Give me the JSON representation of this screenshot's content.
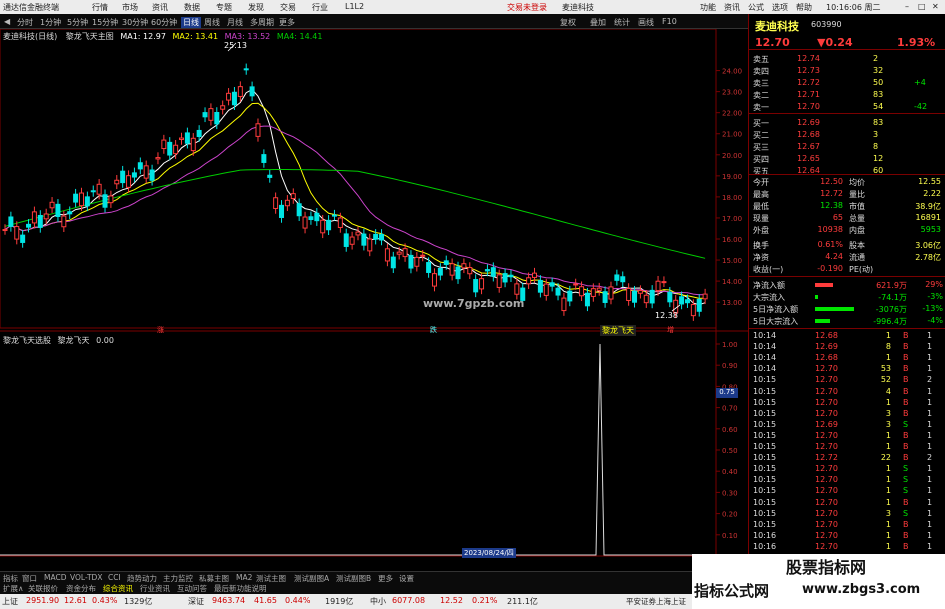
{
  "window": {
    "title": "通达信金融终端",
    "menu": [
      "行情",
      "市场",
      "资讯",
      "数据",
      "专题",
      "发现",
      "交易",
      "行业",
      "L1L2"
    ],
    "account": "交易未登录",
    "stock_tag": "麦迪科技",
    "right_menu": [
      "功能",
      "资讯",
      "公式",
      "选项",
      "帮助"
    ],
    "time": "10:16:06 周二"
  },
  "period_bar": {
    "items": [
      "分时",
      "1分钟",
      "5分钟",
      "15分钟",
      "30分钟",
      "60分钟",
      "日线",
      "周线",
      "月线",
      "多周期",
      "更多"
    ],
    "active": "日线"
  },
  "upper_chart": {
    "header_name": "麦迪科技(日线)",
    "header_formula": "黎龙飞天主图",
    "ma": [
      {
        "label": "MA1: 12.97",
        "color": "#ffffff"
      },
      {
        "label": "MA2: 13.41",
        "color": "#ffff00"
      },
      {
        "label": "MA3: 13.52",
        "color": "#cc44cc"
      },
      {
        "label": "MA4: 14.41",
        "color": "#00cc00"
      }
    ],
    "y_ticks": [
      "24.00",
      "23.00",
      "22.00",
      "21.00",
      "20.00",
      "19.00",
      "18.00",
      "17.00",
      "16.00",
      "15.00",
      "14.00",
      "13.00"
    ],
    "high_label": "25.13",
    "low_label": "12.38",
    "watermark": "www.7gpzb.com",
    "signal_label": "黎龙飞天",
    "markers": [
      "涨",
      "跌",
      "增"
    ]
  },
  "lower_chart": {
    "header_formula": "黎龙飞天选股",
    "header_name": "黎龙飞天",
    "header_value": "0.00",
    "y_ticks": [
      "1.00",
      "0.90",
      "0.80",
      "0.70",
      "0.60",
      "0.50",
      "0.40",
      "0.30",
      "0.20",
      "0.10",
      "0.00"
    ],
    "cursor_value": "0.75",
    "x_labels": [
      "2023年",
      "7",
      "8",
      "9",
      "10"
    ],
    "date_label": "2023/08/24/四",
    "spike_value": 1.0
  },
  "bottom_tabs": [
    "指标",
    "窗口",
    "MACD",
    "VOL-TDX",
    "CCI",
    "趋势动力",
    "主力监控",
    "私募主图",
    "MA2",
    "测试主图",
    "测试副图A",
    "测试副图B",
    "更多",
    "设置"
  ],
  "bottom_tabs2": [
    "扩展∧",
    "关联报价",
    "资金分布",
    "综合资讯",
    "行业资讯",
    "互动问答",
    "最后新功能说明"
  ],
  "right_side_label": "日线",
  "quote": {
    "name": "麦迪科技",
    "code": "603990",
    "price": "12.70",
    "change": "▼0.24",
    "pct": "1.93%",
    "asks": [
      {
        "label": "卖五",
        "price": "12.74",
        "vol": "2",
        "delta": ""
      },
      {
        "label": "卖四",
        "price": "12.73",
        "vol": "32",
        "delta": ""
      },
      {
        "label": "卖三",
        "price": "12.72",
        "vol": "50",
        "delta": "+4"
      },
      {
        "label": "卖二",
        "price": "12.71",
        "vol": "83",
        "delta": ""
      },
      {
        "label": "卖一",
        "price": "12.70",
        "vol": "54",
        "delta": "-42"
      }
    ],
    "bids": [
      {
        "label": "买一",
        "price": "12.69",
        "vol": "83",
        "delta": ""
      },
      {
        "label": "买二",
        "price": "12.68",
        "vol": "3",
        "delta": ""
      },
      {
        "label": "买三",
        "price": "12.67",
        "vol": "8",
        "delta": ""
      },
      {
        "label": "买四",
        "price": "12.65",
        "vol": "12",
        "delta": ""
      },
      {
        "label": "买五",
        "price": "12.64",
        "vol": "60",
        "delta": ""
      }
    ],
    "stats": [
      {
        "l1": "今开",
        "v1": "12.50",
        "l2": "均价",
        "v2": "12.55"
      },
      {
        "l1": "最高",
        "v1": "12.72",
        "l2": "量比",
        "v2": "2.22"
      },
      {
        "l1": "最低",
        "v1": "12.38",
        "l2": "市值",
        "v2": "38.9亿"
      },
      {
        "l1": "现量",
        "v1": "65",
        "l2": "总量",
        "v2": "16891"
      },
      {
        "l1": "外盘",
        "v1": "10938",
        "l2": "内盘",
        "v2": "5953"
      },
      {
        "l1": "换手",
        "v1": "0.61%",
        "l2": "股本",
        "v2": "3.06亿"
      },
      {
        "l1": "净资",
        "v1": "4.24",
        "l2": "流通",
        "v2": "2.78亿"
      },
      {
        "l1": "收益(一)",
        "v1": "-0.190",
        "l2": "PE(动)",
        "v2": ""
      }
    ],
    "flows": [
      {
        "label": "净流入额",
        "value": "621.9万",
        "pct": "29%",
        "bar": 0.3,
        "color": "#ff3c3c"
      },
      {
        "label": "大宗流入",
        "value": "-74.1万",
        "pct": "-3%",
        "bar": 0.05,
        "color": "#00e600"
      },
      {
        "label": "5日净流入额",
        "value": "-3076万",
        "pct": "-13%",
        "bar": 0.65,
        "color": "#00e600"
      },
      {
        "label": "5日大宗流入",
        "value": "-996.4万",
        "pct": "-4%",
        "bar": 0.25,
        "color": "#00e600"
      }
    ],
    "ticks": [
      {
        "t": "10:14",
        "p": "12.68",
        "v": "1",
        "d": "B",
        "n": "1"
      },
      {
        "t": "10:14",
        "p": "12.69",
        "v": "8",
        "d": "B",
        "n": "1"
      },
      {
        "t": "10:14",
        "p": "12.68",
        "v": "1",
        "d": "B",
        "n": "1"
      },
      {
        "t": "10:14",
        "p": "12.70",
        "v": "53",
        "d": "B",
        "n": "1"
      },
      {
        "t": "10:15",
        "p": "12.70",
        "v": "52",
        "d": "B",
        "n": "2"
      },
      {
        "t": "10:15",
        "p": "12.70",
        "v": "4",
        "d": "B",
        "n": "1"
      },
      {
        "t": "10:15",
        "p": "12.70",
        "v": "1",
        "d": "B",
        "n": "1"
      },
      {
        "t": "10:15",
        "p": "12.70",
        "v": "3",
        "d": "B",
        "n": "1"
      },
      {
        "t": "10:15",
        "p": "12.69",
        "v": "3",
        "d": "S",
        "n": "1"
      },
      {
        "t": "10:15",
        "p": "12.70",
        "v": "1",
        "d": "B",
        "n": "1"
      },
      {
        "t": "10:15",
        "p": "12.70",
        "v": "1",
        "d": "B",
        "n": "1"
      },
      {
        "t": "10:15",
        "p": "12.72",
        "v": "22",
        "d": "B",
        "n": "2"
      },
      {
        "t": "10:15",
        "p": "12.70",
        "v": "1",
        "d": "S",
        "n": "1"
      },
      {
        "t": "10:15",
        "p": "12.70",
        "v": "1",
        "d": "S",
        "n": "1"
      },
      {
        "t": "10:15",
        "p": "12.70",
        "v": "1",
        "d": "S",
        "n": "1"
      },
      {
        "t": "10:15",
        "p": "12.70",
        "v": "1",
        "d": "B",
        "n": "1"
      },
      {
        "t": "10:15",
        "p": "12.70",
        "v": "3",
        "d": "S",
        "n": "1"
      },
      {
        "t": "10:15",
        "p": "12.70",
        "v": "1",
        "d": "B",
        "n": "1"
      },
      {
        "t": "10:16",
        "p": "12.70",
        "v": "1",
        "d": "B",
        "n": "1"
      },
      {
        "t": "10:16",
        "p": "12.70",
        "v": "1",
        "d": "B",
        "n": "1"
      }
    ]
  },
  "statusbar": {
    "items": [
      {
        "label": "上证",
        "val": "2951.90",
        "chg": "12.61",
        "pct": "0.43%",
        "amt": "1329亿"
      },
      {
        "label": "深证",
        "val": "9463.74",
        "chg": "41.65",
        "pct": "0.44%",
        "amt": "1919亿"
      },
      {
        "label": "中小",
        "val": "6077.08",
        "chg": "12.52",
        "pct": "0.21%",
        "amt": "211.1亿"
      }
    ],
    "broker": "平安证券上海上证"
  },
  "brand_watermark": {
    "line1": "股票指标网",
    "line2": "指标公式网",
    "line3": "www.zbgs3.com"
  },
  "colors": {
    "up": "#ff3c3c",
    "down": "#00e5e5",
    "ma1": "#ffffff",
    "ma2": "#ffff00",
    "ma3": "#cc44cc",
    "ma4": "#00cc00"
  }
}
